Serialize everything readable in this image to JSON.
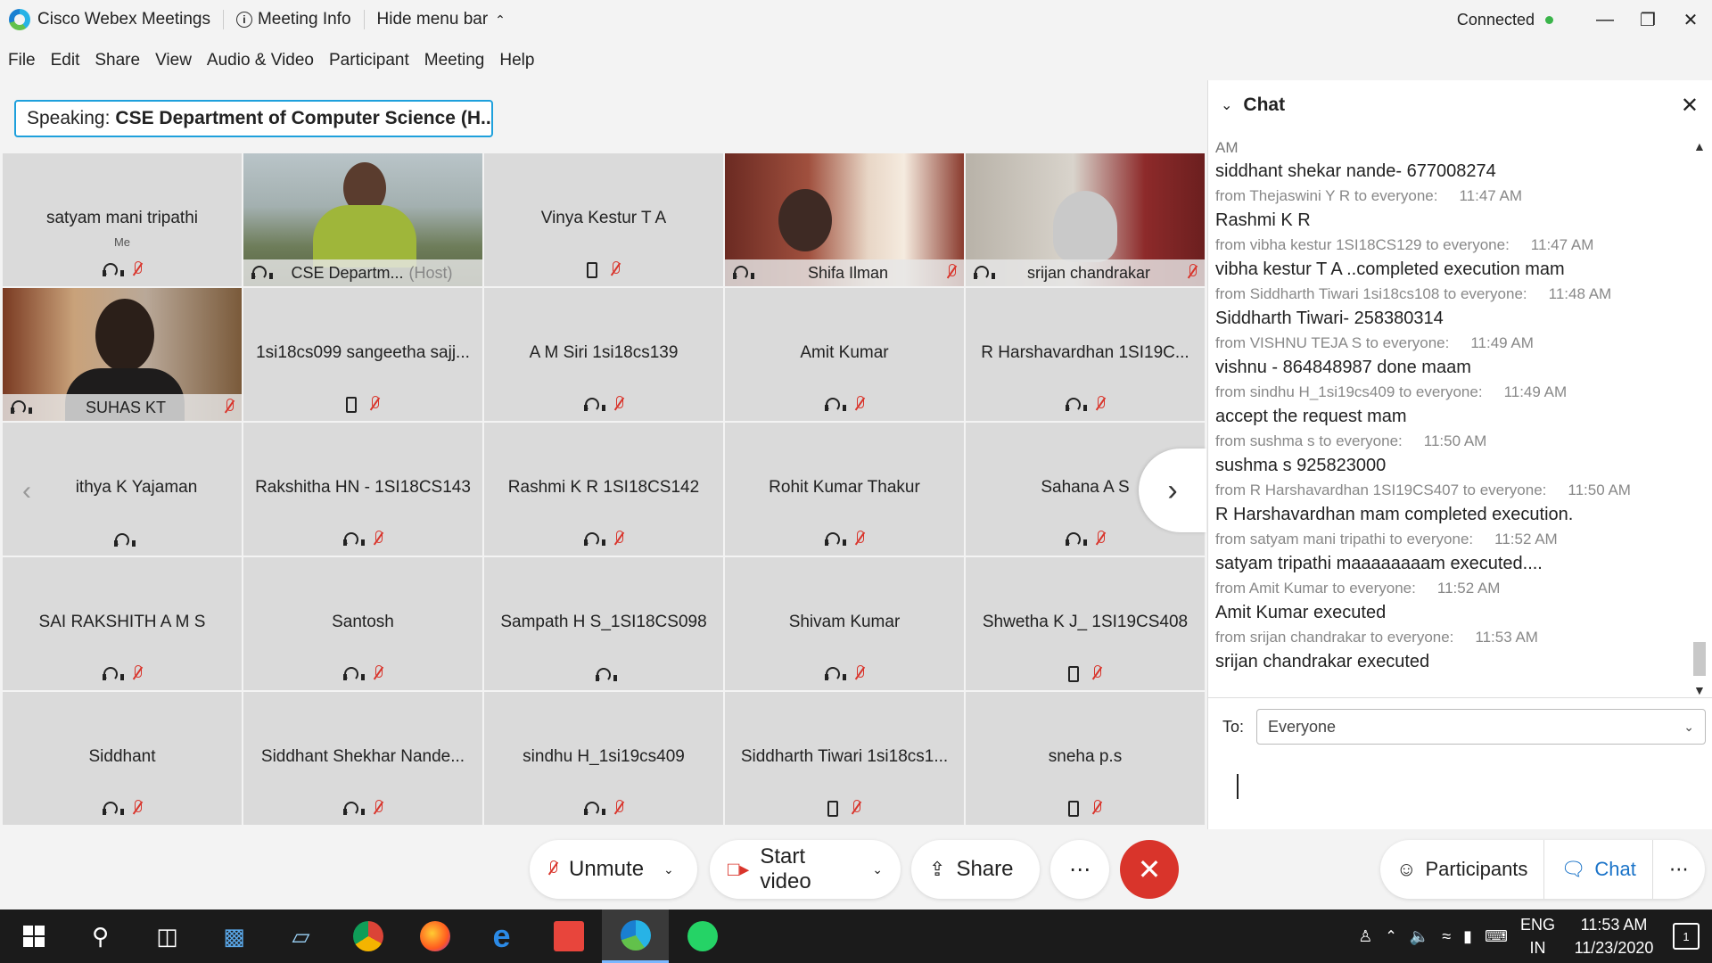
{
  "titlebar": {
    "app_name": "Cisco Webex Meetings",
    "meeting_info": "Meeting Info",
    "hide_menu": "Hide menu bar",
    "status": "Connected",
    "status_color": "#3ab44a"
  },
  "menu": [
    "File",
    "Edit",
    "Share",
    "View",
    "Audio & Video",
    "Participant",
    "Meeting",
    "Help"
  ],
  "speaking": {
    "label": "Speaking:",
    "name": "CSE Department of Computer Science (H..."
  },
  "participants": [
    {
      "name": "satyam mani tripathi",
      "sub": "Me",
      "icons": [
        "headset",
        "mic-muted"
      ]
    },
    {
      "name": "CSE Departm...",
      "host": "(Host)",
      "video": true,
      "icons": [
        "headset"
      ]
    },
    {
      "name": "Vinya Kestur T A",
      "icons": [
        "phone",
        "mic-muted"
      ]
    },
    {
      "name": "Shifa Ilman",
      "video": true,
      "icons": [
        "headset",
        "mic-muted"
      ]
    },
    {
      "name": "srijan chandrakar",
      "video": true,
      "icons": [
        "headset",
        "mic-muted"
      ]
    },
    {
      "name": "SUHAS KT",
      "video": true,
      "icons": [
        "headset",
        "mic-muted"
      ]
    },
    {
      "name": "1si18cs099 sangeetha sajj...",
      "icons": [
        "phone",
        "mic-muted"
      ]
    },
    {
      "name": "A M Siri 1si18cs139",
      "icons": [
        "headset",
        "mic-muted"
      ]
    },
    {
      "name": "Amit Kumar",
      "icons": [
        "headset",
        "mic-muted"
      ]
    },
    {
      "name": "R Harshavardhan 1SI19C...",
      "icons": [
        "headset",
        "mic-muted"
      ]
    },
    {
      "name": "ithya K Yajaman",
      "icons": [
        "headset"
      ]
    },
    {
      "name": "Rakshitha HN - 1SI18CS143",
      "icons": [
        "headset",
        "mic-muted"
      ]
    },
    {
      "name": "Rashmi K R 1SI18CS142",
      "icons": [
        "headset",
        "mic-muted"
      ]
    },
    {
      "name": "Rohit Kumar Thakur",
      "icons": [
        "headset",
        "mic-muted"
      ]
    },
    {
      "name": "Sahana A S",
      "icons": [
        "headset",
        "mic-muted"
      ]
    },
    {
      "name": "SAI RAKSHITH A M S",
      "icons": [
        "headset",
        "mic-muted"
      ]
    },
    {
      "name": "Santosh",
      "icons": [
        "headset",
        "mic-muted"
      ]
    },
    {
      "name": "Sampath H S_1SI18CS098",
      "icons": [
        "headset"
      ]
    },
    {
      "name": "Shivam Kumar",
      "icons": [
        "headset",
        "mic-muted"
      ]
    },
    {
      "name": "Shwetha K J_ 1SI19CS408",
      "icons": [
        "phone",
        "mic-muted"
      ]
    },
    {
      "name": "Siddhant",
      "icons": [
        "headset",
        "mic-muted"
      ]
    },
    {
      "name": "Siddhant Shekhar Nande...",
      "icons": [
        "headset",
        "mic-muted"
      ]
    },
    {
      "name": "sindhu H_1si19cs409",
      "icons": [
        "headset",
        "mic-muted"
      ]
    },
    {
      "name": "Siddharth Tiwari 1si18cs1...",
      "icons": [
        "phone",
        "mic-muted"
      ]
    },
    {
      "name": "sneha p.s",
      "icons": [
        "phone",
        "mic-muted"
      ]
    }
  ],
  "chat": {
    "title": "Chat",
    "continued": "AM",
    "messages": [
      {
        "meta": "",
        "time": "",
        "text": "siddhant shekar nande- 677008274"
      },
      {
        "meta": "from Thejaswini Y R to everyone:",
        "time": "11:47 AM",
        "text": "Rashmi K R"
      },
      {
        "meta": "from vibha kestur 1SI18CS129 to everyone:",
        "time": "11:47 AM",
        "text": "vibha kestur T A ..completed execution mam"
      },
      {
        "meta": "from Siddharth Tiwari 1si18cs108 to everyone:",
        "time": "11:48 AM",
        "text": "Siddharth Tiwari- 258380314"
      },
      {
        "meta": "from VISHNU TEJA S to everyone:",
        "time": "11:49 AM",
        "text": "vishnu - 864848987 done maam"
      },
      {
        "meta": "from sindhu H_1si19cs409 to everyone:",
        "time": "11:49 AM",
        "text": "accept the request mam"
      },
      {
        "meta": "from sushma s to everyone:",
        "time": "11:50 AM",
        "text": "sushma s 925823000"
      },
      {
        "meta": "from R Harshavardhan 1SI19CS407 to everyone:",
        "time": "11:50 AM",
        "text": "R Harshavardhan mam completed execution."
      },
      {
        "meta": "from satyam mani tripathi to everyone:",
        "time": "11:52 AM",
        "text": "satyam tripathi maaaaaaaam executed...."
      },
      {
        "meta": "from Amit Kumar to everyone:",
        "time": "11:52 AM",
        "text": "Amit Kumar executed"
      },
      {
        "meta": "from srijan chandrakar to everyone:",
        "time": "11:53 AM",
        "text": "srijan chandrakar executed"
      }
    ],
    "to_label": "To:",
    "to_value": "Everyone"
  },
  "controls": {
    "unmute": "Unmute",
    "start_video": "Start video",
    "share": "Share",
    "more": "⋯",
    "participants": "Participants",
    "chat": "Chat",
    "end_color": "#d9342b"
  },
  "taskbar": {
    "lang1": "ENG",
    "lang2": "IN",
    "time": "11:53 AM",
    "date": "11/23/2020",
    "notif_count": "1"
  }
}
